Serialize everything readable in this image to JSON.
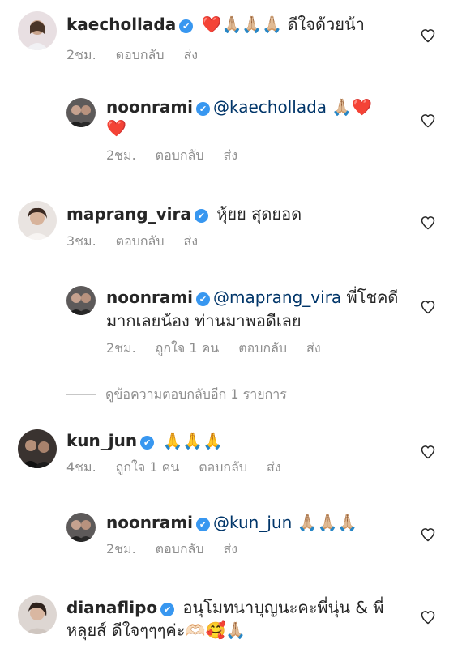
{
  "comments": [
    {
      "username": "kaechollada",
      "verified_mark": "✔",
      "mention": "",
      "text": "❤️🙏🏼🙏🏼🙏🏼 ดีใจด้วยน้า",
      "text_line2": "",
      "time": "2ชม.",
      "likes": "",
      "reply_label": "ตอบกลับ",
      "send_label": "ส่ง"
    },
    {
      "username": "noonrami",
      "verified_mark": "✔",
      "mention": "@kaechollada",
      "text": " 🙏🏼❤️",
      "text_line2": "❤️",
      "time": "2ชม.",
      "likes": "",
      "reply_label": "ตอบกลับ",
      "send_label": "ส่ง"
    },
    {
      "username": "maprang_vira",
      "verified_mark": "✔",
      "mention": "",
      "text": "หุ้ยย สุดยอด",
      "text_line2": "",
      "time": "3ชม.",
      "likes": "",
      "reply_label": "ตอบกลับ",
      "send_label": "ส่ง"
    },
    {
      "username": "noonrami",
      "verified_mark": "✔",
      "mention": "@maprang_vira",
      "text": " พี่โชคดี",
      "text_line2": "มากเลยน้อง  ท่านมาพอดีเลย",
      "time": "2ชม.",
      "likes": "ถูกใจ 1 คน",
      "reply_label": "ตอบกลับ",
      "send_label": "ส่ง"
    },
    {
      "username": "kun_jun",
      "verified_mark": "✔",
      "mention": "",
      "text": "🙏🙏🙏",
      "text_line2": "",
      "time": "4ชม.",
      "likes": "ถูกใจ 1 คน",
      "reply_label": "ตอบกลับ",
      "send_label": "ส่ง"
    },
    {
      "username": "noonrami",
      "verified_mark": "✔",
      "mention": "@kun_jun",
      "text": " 🙏🏼🙏🏼🙏🏼",
      "text_line2": "",
      "time": "2ชม.",
      "likes": "",
      "reply_label": "ตอบกลับ",
      "send_label": "ส่ง"
    },
    {
      "username": "dianaflipo",
      "verified_mark": "✔",
      "mention": "",
      "text": "อนุโมทนาบุญนะคะพี่นุ่น & พี่",
      "text_line2": "หลุยส์ ดีใจๆๆๆค่ะ🫶🏻🥰🙏🏼",
      "time": "",
      "likes": "",
      "reply_label": "",
      "send_label": ""
    }
  ],
  "more_replies": "ดูข้อความตอบกลับอีก 1 รายการ",
  "colors": {
    "text": "#262626",
    "meta": "#8e8e8e",
    "mention": "#003569",
    "verified": "#3897f0"
  },
  "icons": {
    "like": "heart-outline-icon",
    "verified": "verified-badge-icon"
  }
}
